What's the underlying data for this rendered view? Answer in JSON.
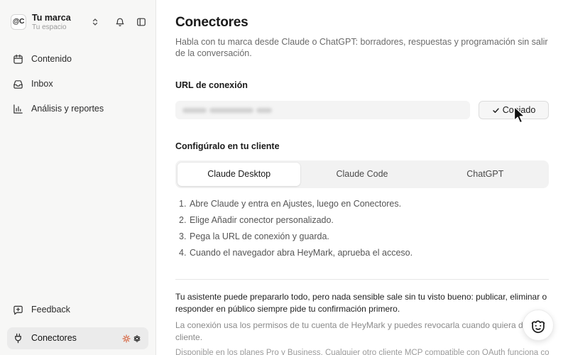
{
  "workspace": {
    "avatar_text": "@C",
    "name": "Tu marca",
    "subtitle": "Tu espacio",
    "switcher_icon": "chevron-up-down-icon",
    "notifications_icon": "bell-icon",
    "sidebar_toggle_icon": "panel-left-icon"
  },
  "nav": {
    "items": [
      {
        "label": "Contenido",
        "icon": "calendar-icon"
      },
      {
        "label": "Inbox",
        "icon": "inbox-icon"
      },
      {
        "label": "Análisis y reportes",
        "icon": "bar-chart-icon"
      }
    ],
    "footer": [
      {
        "label": "Feedback",
        "icon": "message-plus-icon",
        "active": false
      },
      {
        "label": "Conectores",
        "icon": "plug-icon",
        "active": true,
        "badges": [
          "claude-icon",
          "chatgpt-icon"
        ]
      }
    ]
  },
  "page": {
    "title": "Conectores",
    "description": "Habla con tu marca desde Claude o ChatGPT: borradores, respuestas y programación sin salir de la conversación."
  },
  "connection_url": {
    "heading": "URL de conexión",
    "copy_button_label": "Copiado",
    "copy_button_icon": "check-icon"
  },
  "client_setup": {
    "heading": "Configúralo en tu cliente",
    "tabs": [
      {
        "label": "Claude Desktop",
        "active": true
      },
      {
        "label": "Claude Code",
        "active": false
      },
      {
        "label": "ChatGPT",
        "active": false
      }
    ],
    "steps": [
      {
        "number": "1.",
        "text": "Abre Claude y entra en Ajustes, luego en Conectores."
      },
      {
        "number": "2.",
        "text": "Elige Añadir conector personalizado."
      },
      {
        "number": "3.",
        "text": "Pega la URL de conexión y guarda."
      },
      {
        "number": "4.",
        "text": "Cuando el navegador abra HeyMark, aprueba el acceso."
      }
    ]
  },
  "notes": {
    "confirmation": "Tu asistente puede prepararlo todo, pero nada sensible sale sin tu visto bueno: publicar, eliminar o responder en público siempre pide tu confirmación primero.",
    "permissions": "La conexión usa los permisos de tu cuenta de HeyMark y puedes revocarla cuando quiera desde tu cliente.",
    "availability": "Disponible en los planes Pro y Business. Cualquier otro cliente MCP compatible con OAuth funciona con"
  },
  "help_button": {
    "icon": "assistant-face-icon"
  },
  "cursor": {
    "icon": "mouse-pointer-icon"
  },
  "colors": {
    "sidebar_bg": "#f7f7f6",
    "main_bg": "#ffffff",
    "text_primary": "#1a1a1a",
    "text_secondary": "#6b6b6b",
    "active_item_bg": "#ebebeb",
    "border": "#e6e6e6",
    "claude_orange": "#d97757"
  }
}
